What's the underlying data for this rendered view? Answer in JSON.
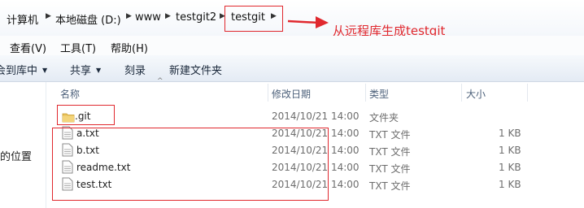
{
  "address_bar": {
    "crumbs": [
      "计算机",
      "本地磁盘 (D:)",
      "www",
      "testgit2",
      "testgit"
    ]
  },
  "menu": {
    "items": [
      "查看(V)",
      "工具(T)",
      "帮助(H)"
    ]
  },
  "toolbar": {
    "items": [
      "会到库中",
      "共享",
      "刻录",
      "新建文件夹"
    ]
  },
  "nav_pane": {
    "partial_label": "的位置"
  },
  "columns": {
    "name": "名称",
    "date": "修改日期",
    "type": "类型",
    "size": "大小"
  },
  "files": [
    {
      "name": ".git",
      "date": "2014/10/21 14:00",
      "type": "文件夹",
      "size": "",
      "icon": "folder-icon"
    },
    {
      "name": "a.txt",
      "date": "2014/10/21 14:00",
      "type": "TXT 文件",
      "size": "1 KB",
      "icon": "text-file-icon"
    },
    {
      "name": "b.txt",
      "date": "2014/10/21 14:00",
      "type": "TXT 文件",
      "size": "1 KB",
      "icon": "text-file-icon"
    },
    {
      "name": "readme.txt",
      "date": "2014/10/21 14:00",
      "type": "TXT 文件",
      "size": "1 KB",
      "icon": "text-file-icon"
    },
    {
      "name": "test.txt",
      "date": "2014/10/21 14:00",
      "type": "TXT 文件",
      "size": "1 KB",
      "icon": "text-file-icon"
    }
  ],
  "annotation": {
    "text": "从远程库生成testgit",
    "color": "#e0282e"
  }
}
